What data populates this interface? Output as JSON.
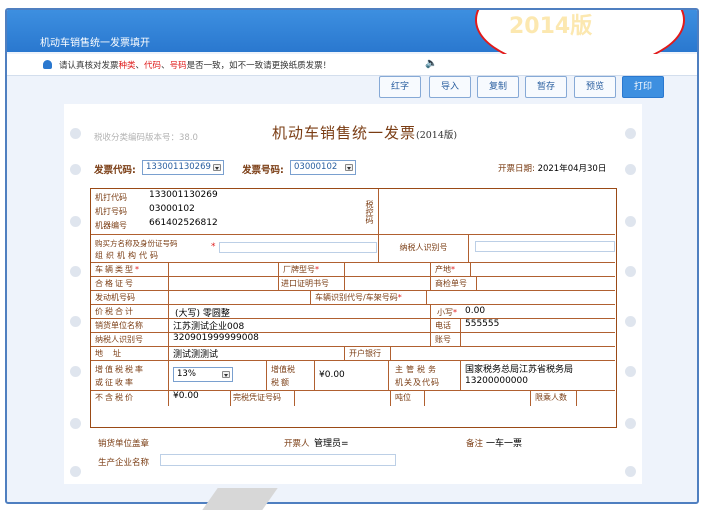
{
  "window": {
    "title": "机动车销售统一发票填开"
  },
  "notice": {
    "prefix": "请认真核对发票",
    "kind": "种类",
    "sep1": "、",
    "code": "代码",
    "sep2": "、",
    "number": "号码",
    "suffix": "是否一致，如不一致请更换纸质发票！"
  },
  "toolbar": {
    "red": "红字",
    "import": "导入",
    "copy": "复制",
    "save": "暂存",
    "preview": "预览",
    "print": "打印"
  },
  "cloud_text": "2014版",
  "paper": {
    "tax_code_version": "税收分类编码版本号：38.0",
    "title": "机动车销售统一发票",
    "title_suffix": "(2014版)",
    "invoice_code_label": "发票代码:",
    "invoice_code": "133001130269",
    "invoice_no_label": "发票号码:",
    "invoice_no": "03000102",
    "date_label": "开票日期:",
    "date": "2021年04月30日"
  },
  "grid": {
    "machine_code_label": "机打代码",
    "machine_code": "133001130269",
    "machine_no_label": "机打号码",
    "machine_no": "03000102",
    "machine_id_label": "机器编号",
    "machine_id": "661402526812",
    "tax_control_label": "税控码",
    "buyer_label_1": "购买方名称及身份证号码",
    "buyer_label_2": "组织机构代码",
    "taxpayer_id_label": "纳税人识别号",
    "vehicle_type_label": "车辆类型",
    "brand_model_label": "厂牌型号",
    "origin_label": "产地",
    "cert_no_label": "合格证号",
    "import_cert_label": "进口证明书号",
    "inspection_no_label": "商检单号",
    "engine_no_label": "发动机号码",
    "vin_label": "车辆识别代号/车架号码",
    "total_label": "价税合计",
    "total_upper": "(大写) 零圆整",
    "small_label": "小写",
    "small_value": "0.00",
    "seller_name_label": "销货单位名称",
    "seller_name": "江苏测试企业008",
    "phone_label": "电话",
    "phone": "555555",
    "seller_tid_label": "纳税人识别号",
    "seller_tid": "320901999999008",
    "account_label": "账号",
    "address_label": "地址",
    "address": "测试测测试",
    "bank_label": "开户银行",
    "vat_rate_label_1": "增值税税率",
    "vat_rate_label_2": "或征收率",
    "vat_rate": "13%",
    "vat_amount_label_1": "增值税",
    "vat_amount_label_2": "税额",
    "vat_amount": "¥0.00",
    "tax_office_label_1": "主管税务",
    "tax_office_label_2": "机关及代码",
    "tax_office_name": "国家税务总局江苏省税务局",
    "tax_office_code": "13200000000",
    "pretax_label": "不含税价",
    "pretax": "¥0.00",
    "customs_label": "完税凭证号码",
    "tonnage_label": "吨位",
    "capacity_label": "限乘人数"
  },
  "footer": {
    "seal_label": "销货单位盖章",
    "issuer_label": "开票人",
    "issuer": "管理员=",
    "remark_label": "备注",
    "remark": "一车一票",
    "manufacturer_label": "生产企业名称"
  }
}
